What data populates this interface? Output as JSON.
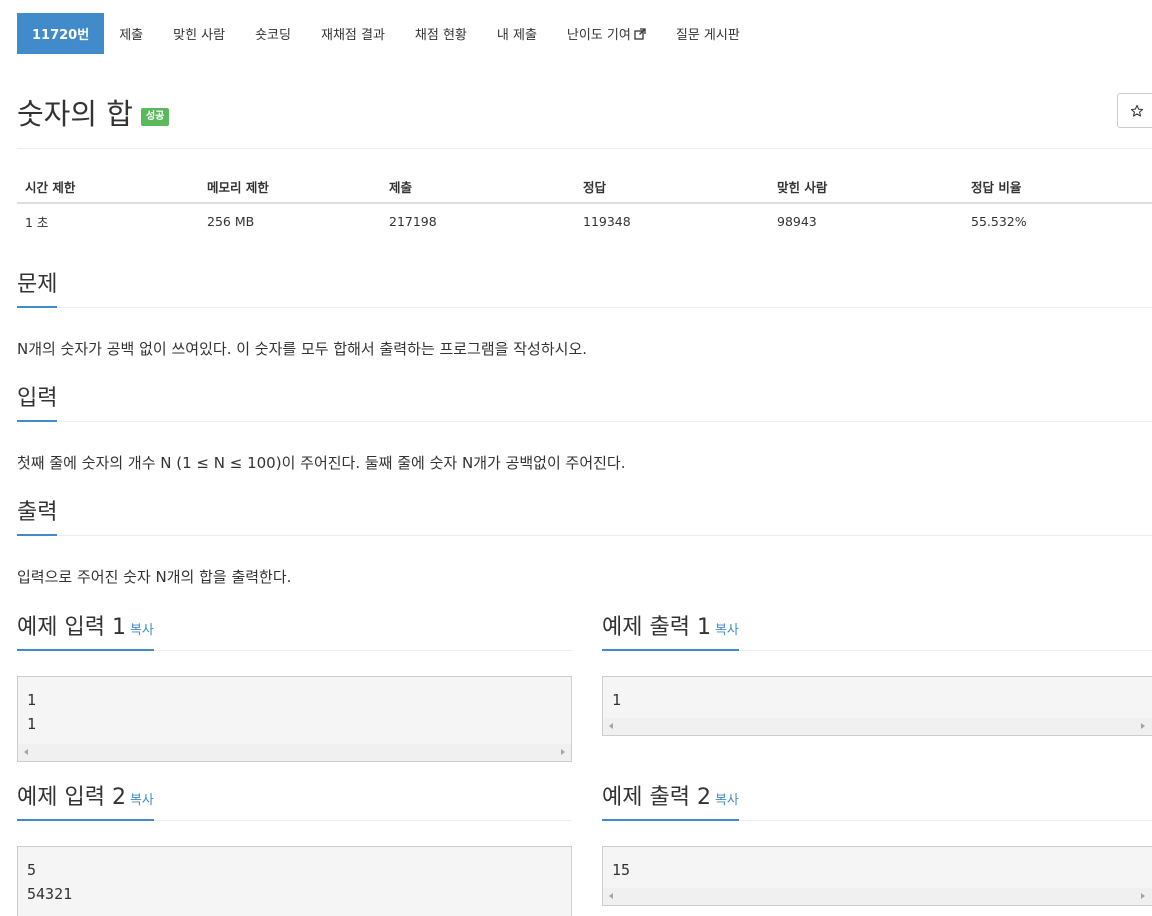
{
  "nav": {
    "items": [
      {
        "label": "11720번",
        "active": true
      },
      {
        "label": "제출"
      },
      {
        "label": "맞힌 사람"
      },
      {
        "label": "숏코딩"
      },
      {
        "label": "재채점 결과"
      },
      {
        "label": "채점 현황"
      },
      {
        "label": "내 제출"
      },
      {
        "label": "난이도 기여",
        "external": true
      },
      {
        "label": "질문 게시판"
      }
    ]
  },
  "problem": {
    "title": "숫자의 합",
    "badge": "성공",
    "badge_color": "#5cb85c",
    "star_icon": "star-outline-icon"
  },
  "info": {
    "headers": [
      "시간 제한",
      "메모리 제한",
      "제출",
      "정답",
      "맞힌 사람",
      "정답 비율"
    ],
    "values": [
      "1 초",
      "256 MB",
      "217198",
      "119348",
      "98943",
      "55.532%"
    ]
  },
  "sections": {
    "problem_heading": "문제",
    "problem_text": "N개의 숫자가 공백 없이 쓰여있다. 이 숫자를 모두 합해서 출력하는 프로그램을 작성하시오.",
    "input_heading": "입력",
    "input_text": "첫째 줄에 숫자의 개수 N (1 ≤ N ≤ 100)이 주어진다. 둘째 줄에 숫자 N개가 공백없이 주어진다.",
    "output_heading": "출력",
    "output_text": "입력으로 주어진 숫자 N개의 합을 출력한다."
  },
  "samples": {
    "copy_label": "복사",
    "input1_heading": "예제 입력 1",
    "input1_text": "1\n1",
    "output1_heading": "예제 출력 1",
    "output1_text": "1",
    "input2_heading": "예제 입력 2",
    "input2_text": "5\n54321",
    "output2_heading": "예제 출력 2",
    "output2_text": "15"
  },
  "colors": {
    "accent": "#428bca",
    "success": "#5cb85c"
  }
}
